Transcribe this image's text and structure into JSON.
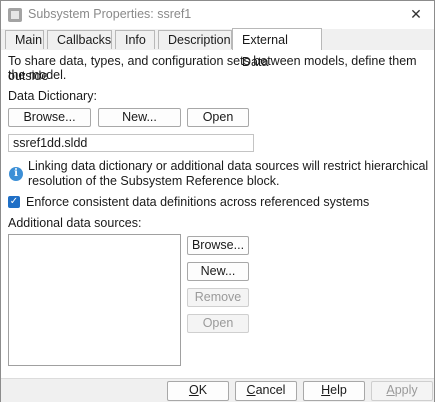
{
  "window": {
    "title": "Subsystem Properties: ssref1",
    "close_symbol": "✕"
  },
  "tabs": [
    {
      "label": "Main"
    },
    {
      "label": "Callbacks"
    },
    {
      "label": "Info"
    },
    {
      "label": "Description"
    },
    {
      "label": "External Data",
      "active": true
    }
  ],
  "intro_line1": "To share data, types, and configuration sets between models, define them outside",
  "intro_line2": "the model.",
  "dictionary": {
    "label": "Data Dictionary:",
    "browse": "Browse...",
    "new": "New...",
    "open": "Open",
    "value": "ssref1dd.sldd"
  },
  "info_note": {
    "line1": "Linking data dictionary or additional data sources will restrict hierarchical",
    "line2": "resolution of the Subsystem Reference block."
  },
  "enforce": {
    "label": "Enforce consistent data definitions across referenced systems",
    "checked": true
  },
  "sources": {
    "label": "Additional data sources:",
    "browse": "Browse...",
    "new": "New...",
    "remove": "Remove",
    "open": "Open"
  },
  "footer": {
    "ok_first": "O",
    "ok_rest": "K",
    "cancel_first": "C",
    "cancel_rest": "ancel",
    "help_first": "H",
    "help_rest": "elp",
    "apply_first": "A",
    "apply_rest": "pply"
  }
}
